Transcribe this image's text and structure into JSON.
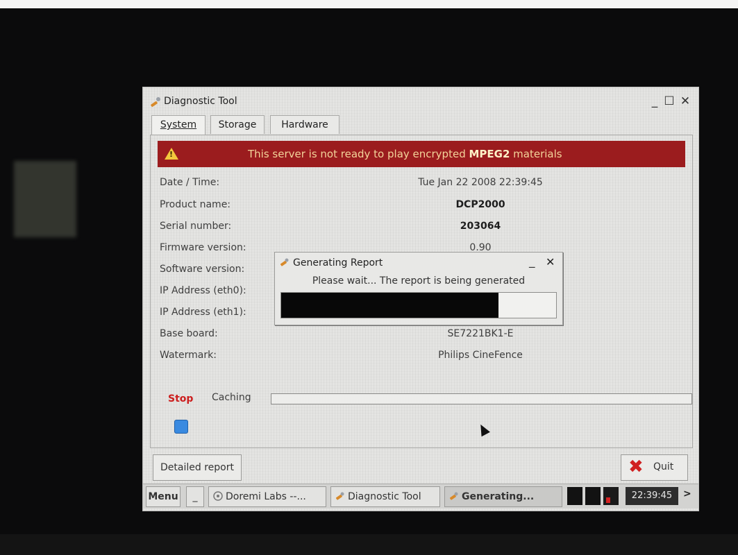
{
  "window": {
    "title": "Diagnostic Tool",
    "minimize": "_",
    "maximize": "☐",
    "close": "✕"
  },
  "tabs": [
    {
      "label": "System",
      "active": true
    },
    {
      "label": "Storage",
      "active": false
    },
    {
      "label": "Hardware",
      "active": false
    }
  ],
  "alert": {
    "text_before": "This server is not ready to play encrypted ",
    "text_bold": "MPEG2",
    "text_after": " materials",
    "icon": "warning-icon",
    "color": "#9b1c1e"
  },
  "info": [
    {
      "label": "Date / Time:",
      "value": "Tue Jan 22 2008 22:39:45"
    },
    {
      "label": "Product name:",
      "value": "DCP2000"
    },
    {
      "label": "Serial number:",
      "value": "203064"
    },
    {
      "label": "Firmware version:",
      "value": "0.90"
    },
    {
      "label": "Software version:",
      "value": ""
    },
    {
      "label": "IP Address (eth0):",
      "value": ""
    },
    {
      "label": "IP Address (eth1):",
      "value": ""
    },
    {
      "label": "Base board:",
      "value": "SE7221BK1-E"
    },
    {
      "label": "Watermark:",
      "value": "Philips CineFence"
    }
  ],
  "caching": {
    "stop_label": "Stop",
    "label": "Caching",
    "progress": 0
  },
  "buttons": {
    "detailed_report": "Detailed report",
    "quit": "Quit"
  },
  "dialog": {
    "title": "Generating Report",
    "message": "Please wait... The report is being generated",
    "progress": 0.79,
    "minimize": "_",
    "close": "✕"
  },
  "taskbar": {
    "menu": "Menu",
    "minimize_all": "_",
    "items": [
      {
        "label": "Doremi Labs --...",
        "icon": "doremi-icon"
      },
      {
        "label": "Diagnostic Tool",
        "icon": "wrench-icon"
      },
      {
        "label": "Generating...",
        "icon": "wrench-icon",
        "active": true
      }
    ],
    "clock": "22:39:45",
    "more": ">"
  }
}
